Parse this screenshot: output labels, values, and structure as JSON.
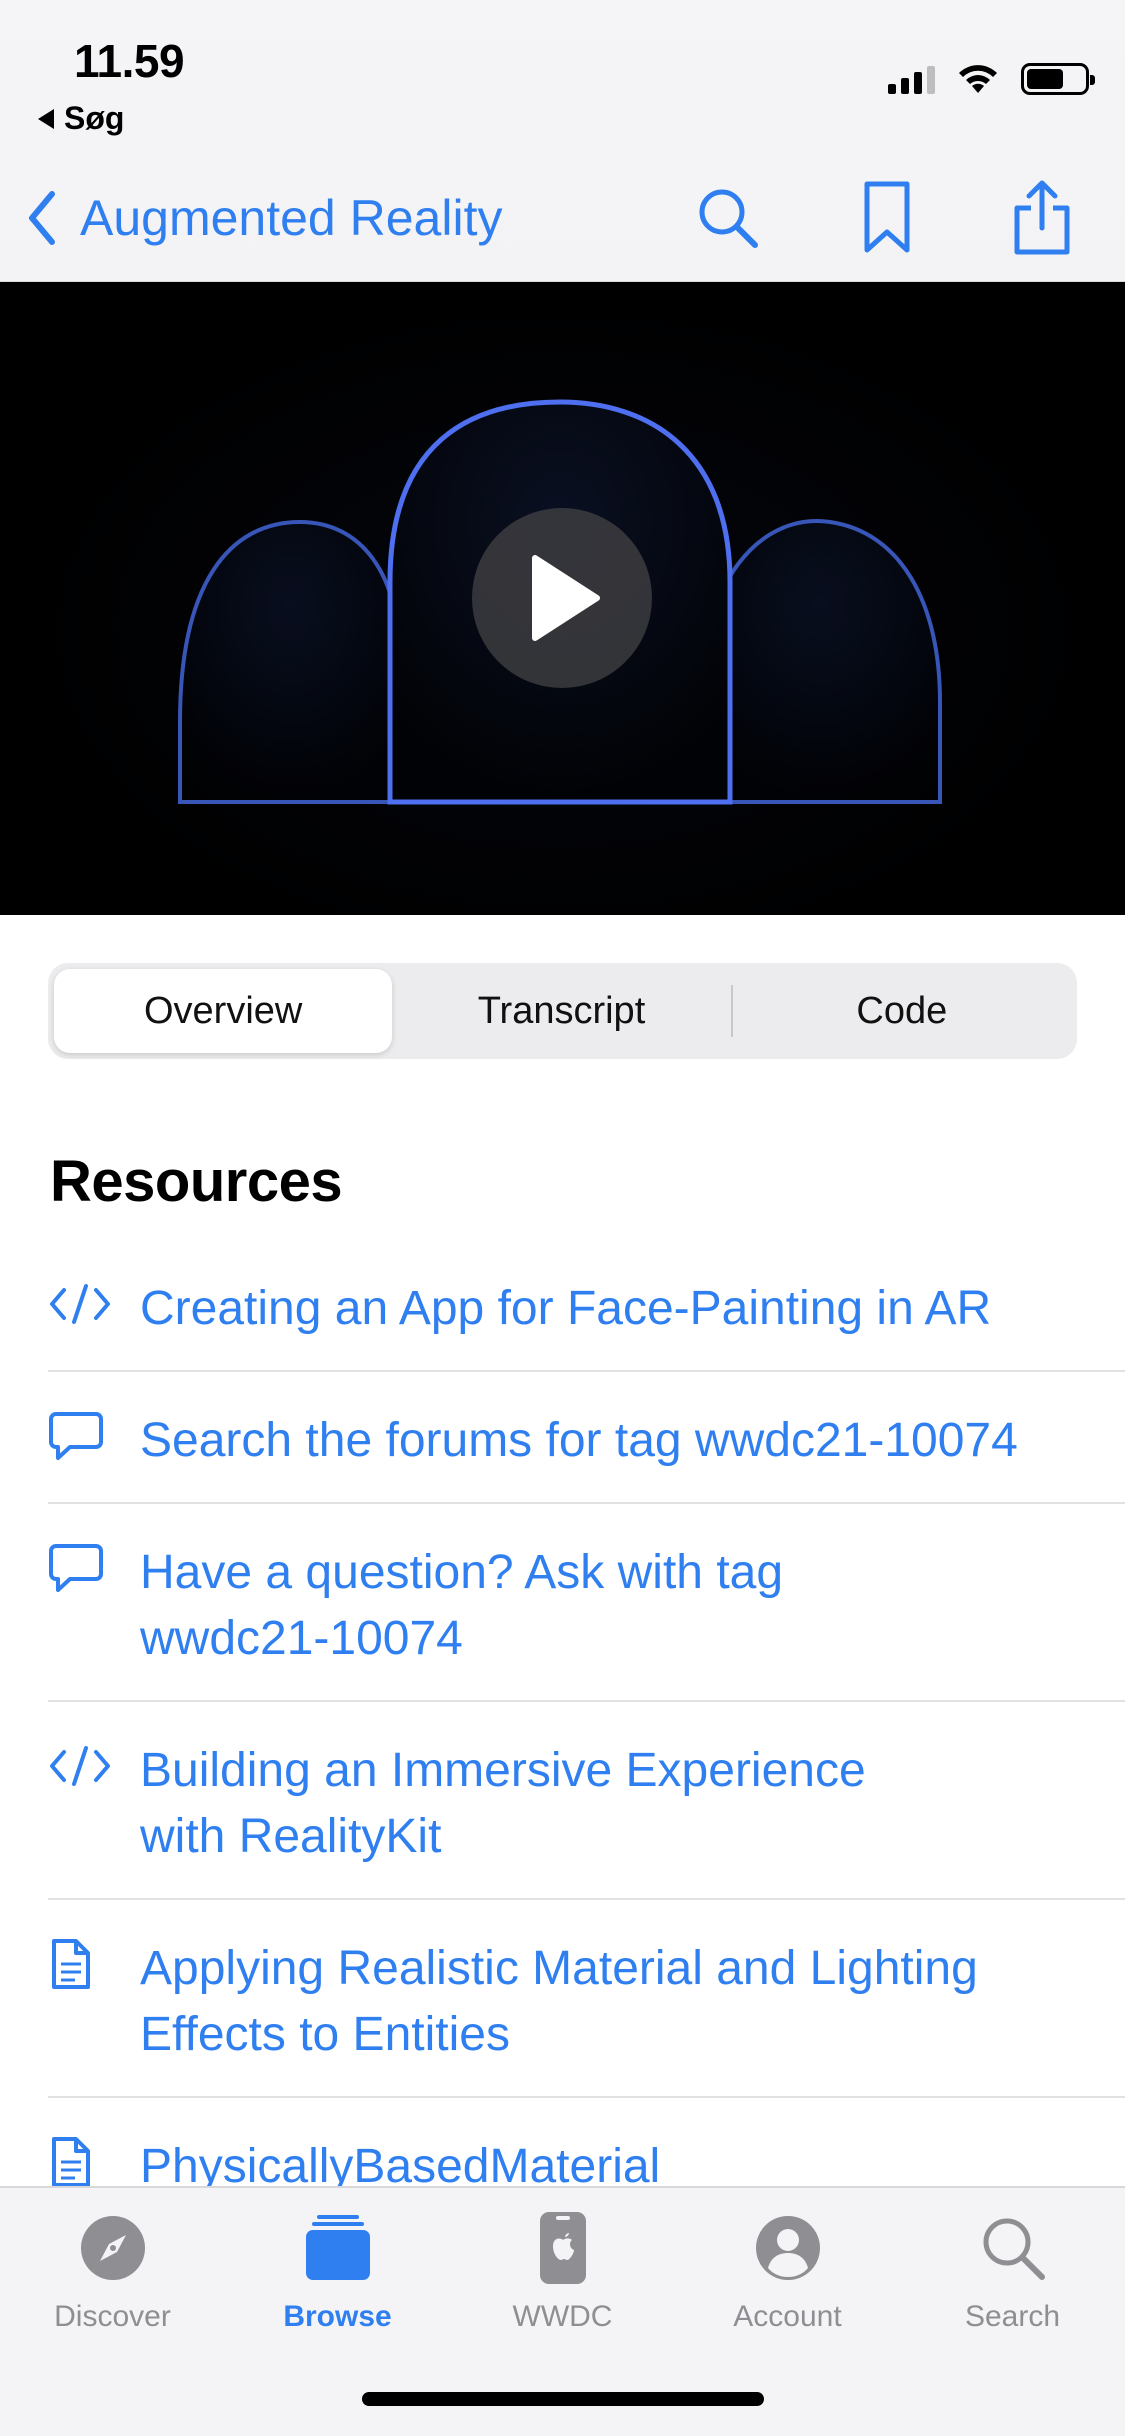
{
  "status_bar": {
    "time": "11.59",
    "back_app": "Søg"
  },
  "nav": {
    "back_label": "Augmented Reality",
    "icons": [
      "search-icon",
      "bookmark-icon",
      "share-icon"
    ]
  },
  "video": {
    "play_icon": "play-icon"
  },
  "segments": {
    "items": [
      "Overview",
      "Transcript",
      "Code"
    ],
    "selected": "Overview"
  },
  "resources": {
    "title": "Resources",
    "items": [
      {
        "icon": "code-icon",
        "text": "Creating an App for Face-Painting in AR"
      },
      {
        "icon": "chat-bubble-icon",
        "text": "Search the forums for tag wwdc21-10074"
      },
      {
        "icon": "chat-bubble-icon",
        "text": "Have a question? Ask with tag wwdc21-10074"
      },
      {
        "icon": "code-icon",
        "text": "Building an Immersive Experience with RealityKit"
      },
      {
        "icon": "document-icon",
        "text": "Applying Realistic Material and Lighting Effects to Entities"
      },
      {
        "icon": "document-icon",
        "text": "PhysicallyBasedMaterial"
      }
    ]
  },
  "tabbar": {
    "items": [
      {
        "label": "Discover",
        "icon": "compass-icon"
      },
      {
        "label": "Browse",
        "icon": "stack-icon"
      },
      {
        "label": "WWDC",
        "icon": "apple-device-icon"
      },
      {
        "label": "Account",
        "icon": "person-icon"
      },
      {
        "label": "Search",
        "icon": "search-icon"
      }
    ],
    "selected": "Browse"
  },
  "colors": {
    "accent": "#2f7ff0",
    "inactive": "#8e8e93"
  }
}
